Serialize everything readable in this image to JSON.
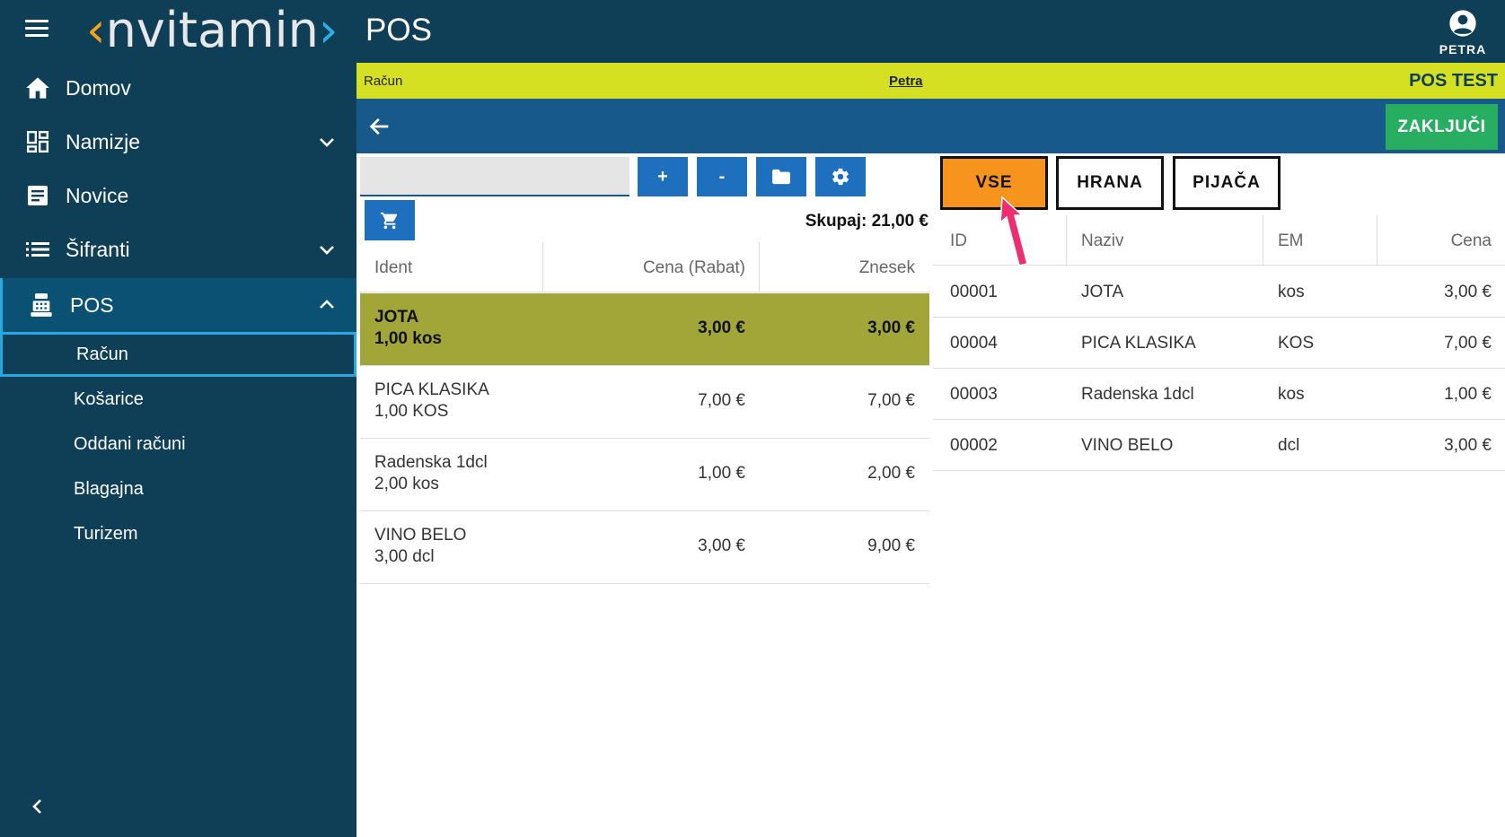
{
  "logo": {
    "left_bracket": "‹",
    "text": "nvitamin",
    "right_bracket": "›"
  },
  "sidebar": {
    "items": [
      {
        "label": "Domov",
        "icon": "home-icon",
        "has_chevron": false
      },
      {
        "label": "Namizje",
        "icon": "dashboard-icon",
        "has_chevron": true
      },
      {
        "label": "Novice",
        "icon": "news-icon",
        "has_chevron": false
      },
      {
        "label": "Šifranti",
        "icon": "list-icon",
        "has_chevron": true
      },
      {
        "label": "POS",
        "icon": "cash-register-icon",
        "has_chevron": true,
        "active": true
      }
    ],
    "sub_items": [
      {
        "label": "Račun",
        "active": true
      },
      {
        "label": "Košarice"
      },
      {
        "label": "Oddani računi"
      },
      {
        "label": "Blagajna"
      },
      {
        "label": "Turizem"
      }
    ]
  },
  "topbar": {
    "title": "POS",
    "user": "PETRA"
  },
  "infobar": {
    "left": "Račun",
    "center": "Petra",
    "right": "POS TEST"
  },
  "actionbar": {
    "finish_label": "ZAKLJUČI"
  },
  "toolbar": {
    "plus": "+",
    "minus": "-",
    "search_value": ""
  },
  "cart": {
    "total_label": "Skupaj: 21,00 €",
    "columns": [
      "Ident",
      "Cena (Rabat)",
      "Znesek"
    ],
    "rows": [
      {
        "name": "JOTA",
        "qty": "1,00 kos",
        "price": "3,00 €",
        "amount": "3,00 €",
        "selected": true
      },
      {
        "name": "PICA KLASIKA",
        "qty": "1,00 KOS",
        "price": "7,00 €",
        "amount": "7,00 €"
      },
      {
        "name": "Radenska 1dcl",
        "qty": "2,00 kos",
        "price": "1,00 €",
        "amount": "2,00 €"
      },
      {
        "name": "VINO BELO",
        "qty": "3,00 dcl",
        "price": "3,00 €",
        "amount": "9,00 €"
      }
    ]
  },
  "categories": [
    {
      "label": "VSE",
      "active": true
    },
    {
      "label": "HRANA"
    },
    {
      "label": "PIJAČA"
    }
  ],
  "products": {
    "columns": [
      "ID",
      "Naziv",
      "EM",
      "Cena"
    ],
    "rows": [
      {
        "id": "00001",
        "name": "JOTA",
        "unit": "kos",
        "price": "3,00 €"
      },
      {
        "id": "00004",
        "name": "PICA KLASIKA",
        "unit": "KOS",
        "price": "7,00 €"
      },
      {
        "id": "00003",
        "name": "Radenska 1dcl",
        "unit": "kos",
        "price": "1,00 €"
      },
      {
        "id": "00002",
        "name": "VINO BELO",
        "unit": "dcl",
        "price": "3,00 €"
      }
    ]
  },
  "colors": {
    "sidebar": "#0e3f57",
    "accent": "#27a8e0",
    "infobar": "#d5e022",
    "actionbar": "#16598a",
    "finish": "#27ae60",
    "active_category": "#f7941d",
    "selected_row": "#a2a538",
    "arrow": "#ee2f6f"
  }
}
